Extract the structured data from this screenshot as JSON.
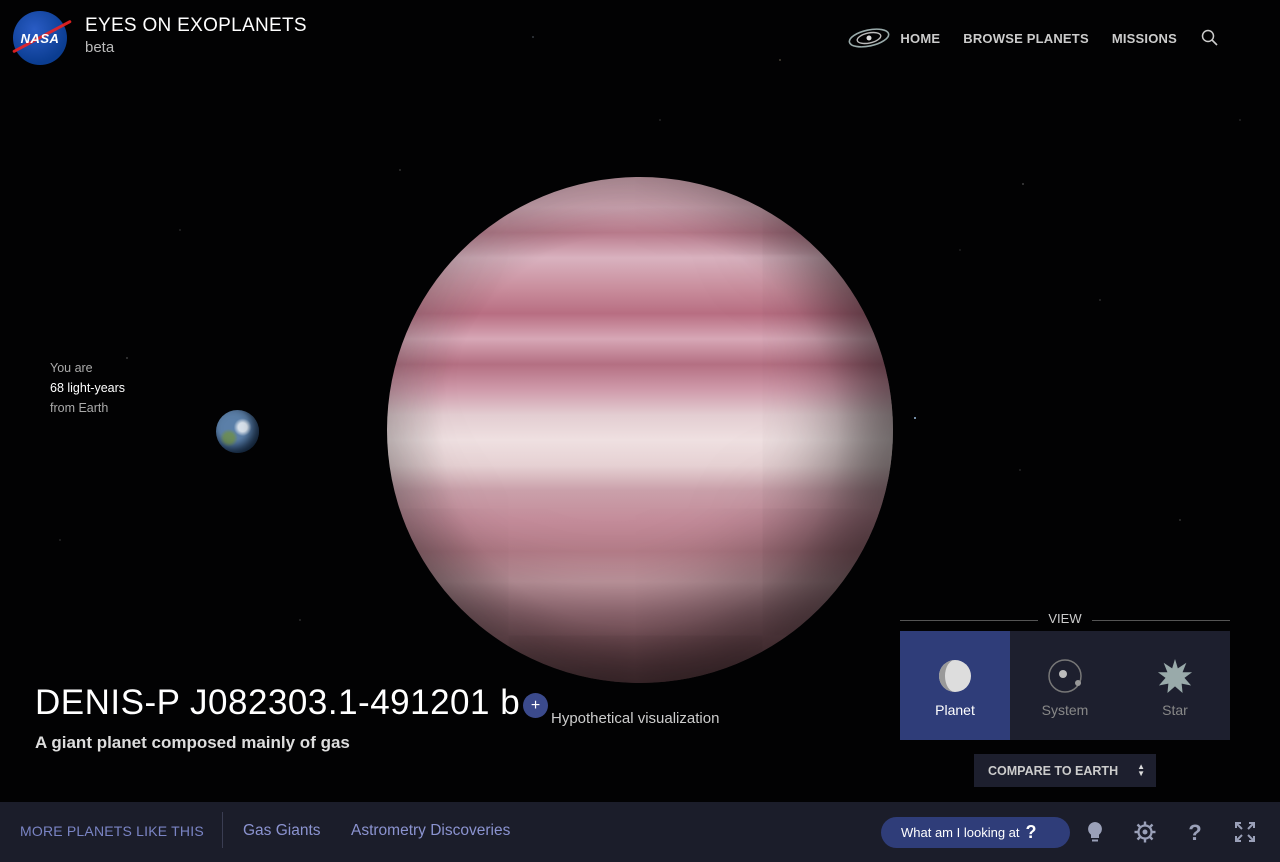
{
  "header": {
    "logo_text": "NASA",
    "title": "EYES ON EXOPLANETS",
    "subtitle": "beta",
    "nav": [
      {
        "label": "HOME",
        "icon": "galaxy-icon"
      },
      {
        "label": "BROWSE PLANETS"
      },
      {
        "label": "MISSIONS"
      }
    ]
  },
  "distance": {
    "line1": "You are",
    "line2": "68 light-years",
    "line3": "from Earth"
  },
  "planet": {
    "name": "DENIS-P J082303.1-491201 b",
    "plus_label": "+",
    "visualization_note": "Hypothetical visualization",
    "description": "A giant planet composed mainly of gas"
  },
  "view": {
    "label": "VIEW",
    "options": [
      {
        "label": "Planet",
        "icon": "planet-icon",
        "active": true
      },
      {
        "label": "System",
        "icon": "system-icon",
        "active": false
      },
      {
        "label": "Star",
        "icon": "star-icon",
        "active": false
      }
    ],
    "compare_label": "COMPARE TO EARTH",
    "compare_arrows": "▲\n▼"
  },
  "bottom": {
    "more_label": "MORE PLANETS LIKE THIS",
    "tags": [
      "Gas Giants",
      "Astrometry Discoveries"
    ],
    "what_label": "What am I looking at",
    "what_q": "?",
    "icons": [
      "lightbulb-icon",
      "settings-icon",
      "help-icon",
      "fullscreen-icon"
    ]
  },
  "colors": {
    "accent": "#2f3d79",
    "bar_bg": "#1b1d2a",
    "link": "#8b93d0"
  }
}
